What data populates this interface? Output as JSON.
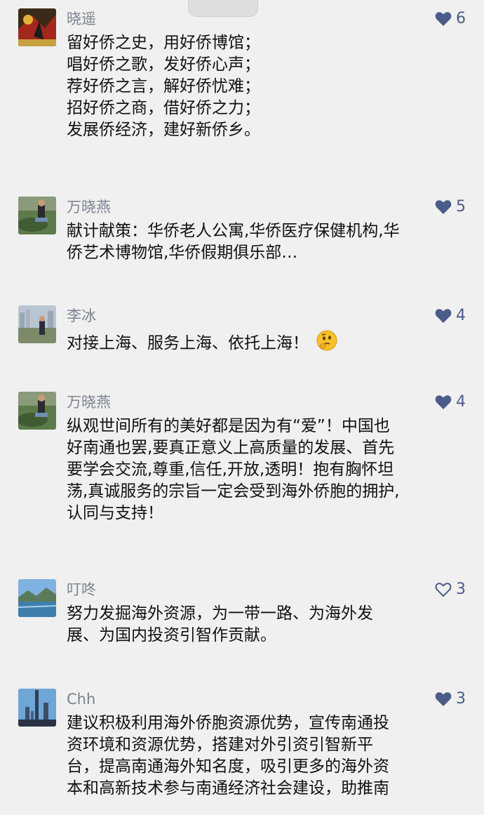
{
  "colors": {
    "background": "#f0f0f0",
    "name": "#7b8290",
    "like_filled": "#4c5c8a",
    "text": "#111111"
  },
  "comments": [
    {
      "name": "晓遥",
      "likes": "6",
      "liked": true,
      "lines": [
        "留好侨之史，用好侨博馆；",
        "唱好侨之歌，发好侨心声；",
        "荐好侨之言，解好侨忧难；",
        "招好侨之商，借好侨之力；",
        "发展侨经济，建好新侨乡。"
      ]
    },
    {
      "name": "万晓燕",
      "likes": "5",
      "liked": true,
      "lines": [
        "献计献策：华侨老人公寓,华侨医疗保健机构,华",
        "侨艺术博物馆,华侨假期俱乐部…"
      ]
    },
    {
      "name": "李冰",
      "likes": "4",
      "liked": true,
      "lines": [
        "对接上海、服务上海、依托上海！"
      ],
      "emoji": "thinking-face"
    },
    {
      "name": "万晓燕",
      "likes": "4",
      "liked": true,
      "lines": [
        "纵观世间所有的美好都是因为有“爱”！中国也",
        "好南通也罢,要真正意义上高质量的发展、首先",
        "要学会交流,尊重,信任,开放,透明！抱有胸怀坦",
        "荡,真诚服务的宗旨一定会受到海外侨胞的拥护,",
        "认同与支持！"
      ]
    },
    {
      "name": "叮咚",
      "likes": "3",
      "liked": false,
      "lines": [
        "努力发掘海外资源，为一带一路、为海外发",
        "展、为国内投资引智作贡献。"
      ]
    },
    {
      "name": "Chh",
      "likes": "3",
      "liked": true,
      "lines": [
        "建议积极利用海外侨胞资源优势，宣传南通投",
        "资环境和资源优势，搭建对外引资引智新平",
        "台，提高南通海外知名度，吸引更多的海外资",
        "本和高新技术参与南通经济社会建设，助推南"
      ]
    }
  ]
}
